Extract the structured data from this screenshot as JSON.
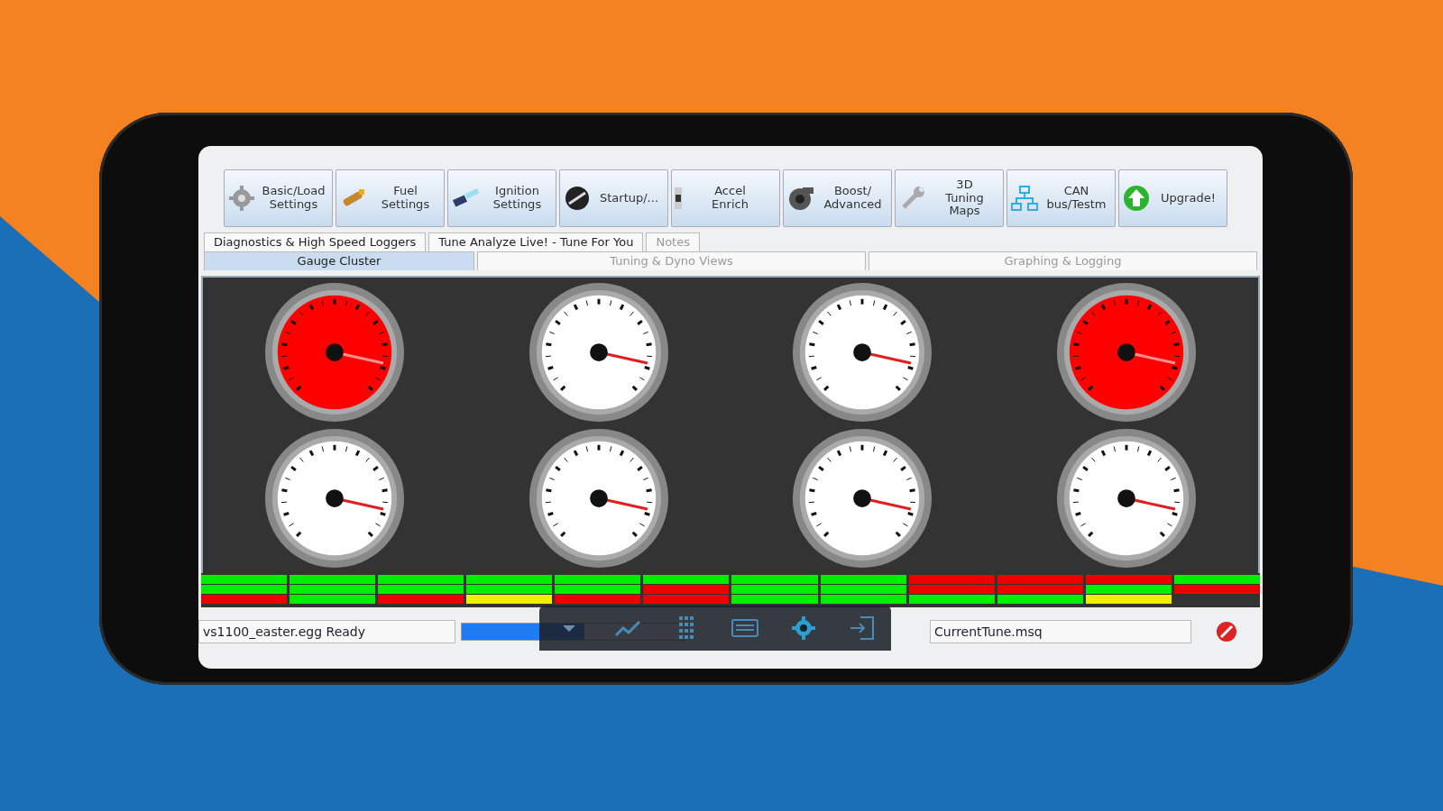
{
  "toolbar": {
    "buttons": [
      {
        "label": "Basic/Load\nSettings"
      },
      {
        "label": "Fuel\nSettings"
      },
      {
        "label": "Ignition\nSettings"
      },
      {
        "label": "Startup/..."
      },
      {
        "label": "Accel\nEnrich"
      },
      {
        "label": "Boost/\nAdvanced"
      },
      {
        "label": "3D\nTuning\nMaps"
      },
      {
        "label": "CAN\nbus/Testm"
      },
      {
        "label": "Upgrade!"
      }
    ]
  },
  "tab_rows": [
    [
      {
        "label": "Diagnostics & High Speed Loggers",
        "selected": false,
        "disabled": false
      },
      {
        "label": "Tune Analyze Live! - Tune For You",
        "selected": false,
        "disabled": false
      },
      {
        "label": "Notes",
        "selected": false,
        "disabled": true
      }
    ],
    [
      {
        "label": "Gauge Cluster",
        "selected": true,
        "disabled": false
      },
      {
        "label": "Tuning & Dyno Views",
        "selected": false,
        "disabled": true
      },
      {
        "label": "Graphing & Logging",
        "selected": false,
        "disabled": true
      }
    ]
  ],
  "gauges": [
    {
      "color": "#ff0000"
    },
    {
      "color": "#ffffff"
    },
    {
      "color": "#ffffff"
    },
    {
      "color": "#ff0000"
    },
    {
      "color": "#ffffff"
    },
    {
      "color": "#ffffff"
    },
    {
      "color": "#ffffff"
    },
    {
      "color": "#ffffff"
    }
  ],
  "indicator_rows": [
    [
      {
        "color": "#00ee00"
      },
      {
        "color": "#00ee00"
      },
      {
        "color": "#00ee00"
      },
      {
        "color": "#00ee00"
      },
      {
        "color": "#00ee00"
      },
      {
        "color": "#00ee00"
      },
      {
        "color": "#00ee00"
      },
      {
        "color": "#00ee00"
      },
      {
        "color": "#ee0000"
      },
      {
        "color": "#ee0000"
      },
      {
        "color": "#ee0000"
      },
      {
        "color": "#00ee00"
      }
    ],
    [
      {
        "color": "#00ee00"
      },
      {
        "color": "#00ee00"
      },
      {
        "color": "#00ee00"
      },
      {
        "color": "#00ee00"
      },
      {
        "color": "#00ee00"
      },
      {
        "color": "#ee0000"
      },
      {
        "color": "#00ee00"
      },
      {
        "color": "#00ee00"
      },
      {
        "color": "#ee0000"
      },
      {
        "color": "#ee0000"
      },
      {
        "color": "#00ee00"
      },
      {
        "color": "#ee0000"
      }
    ],
    [
      {
        "color": "#ee0000"
      },
      {
        "color": "#00ee00"
      },
      {
        "color": "#ee0000"
      },
      {
        "color": "#eeee00"
      },
      {
        "color": "#ee0000"
      },
      {
        "color": "#ee0000"
      },
      {
        "color": "#00ee00"
      },
      {
        "color": "#00ee00"
      },
      {
        "color": "#00ee00"
      },
      {
        "color": "#00ee00"
      },
      {
        "color": "#eeee00"
      }
    ]
  ],
  "status_bar": {
    "message": "vs1100_easter.egg Ready",
    "progress": {
      "level": 0.55
    },
    "tune_file": "CurrentTune.msq"
  }
}
